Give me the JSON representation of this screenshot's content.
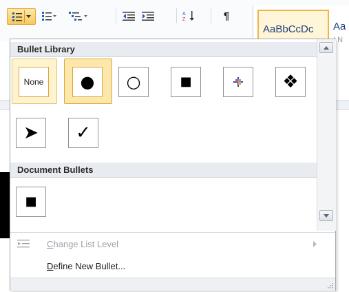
{
  "ribbon": {
    "style_preview": "AaBbCcDc",
    "style_preview_2": "Aa",
    "style_sub": "I N"
  },
  "bullet_library": {
    "header": "Bullet Library",
    "row1": [
      {
        "label": "None",
        "symbol": ""
      },
      {
        "label": "",
        "symbol": "●"
      },
      {
        "label": "",
        "symbol": "○"
      },
      {
        "label": "",
        "symbol": "■"
      },
      {
        "label": "",
        "symbol": "picture-bullet-icon"
      },
      {
        "label": "",
        "symbol": "❖"
      }
    ],
    "row2": [
      {
        "label": "",
        "symbol": "➤"
      },
      {
        "label": "",
        "symbol": "✓"
      }
    ]
  },
  "document_bullets": {
    "header": "Document Bullets",
    "items": [
      {
        "symbol": "■"
      }
    ]
  },
  "menu": {
    "change_list_level_pre": "",
    "change_list_level_u": "C",
    "change_list_level_post": "hange List Level",
    "define_new_bullet_u": "D",
    "define_new_bullet_post": "efine New Bullet..."
  },
  "colors": {
    "accent_border": "#e0a33c",
    "highlight_bg": "#fde8ac",
    "section_bg": "#e8ebef",
    "disabled_text": "#9ba1a8"
  }
}
